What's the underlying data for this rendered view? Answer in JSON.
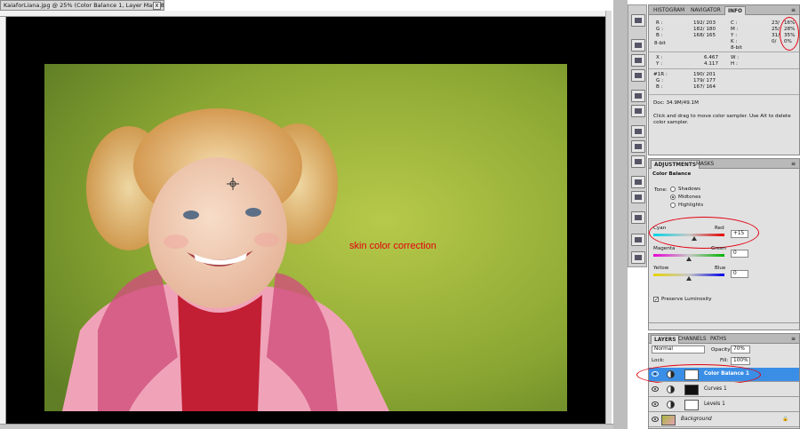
{
  "document": {
    "tab_title": "KaiaforLiana.jpg @ 25% (Color Balance 1, Layer Mask/8) *",
    "close_glyph": "x",
    "image_label": "skin color correction"
  },
  "info_panel": {
    "tabs": [
      "HISTOGRAM",
      "NAVIGATOR",
      "INFO"
    ],
    "active_tab": "INFO",
    "rgb_block": {
      "labels": [
        "R :",
        "G :",
        "B :"
      ],
      "values": [
        "192/  203",
        "182/  180",
        "168/  165"
      ],
      "bit": "8-bit"
    },
    "cmyk_block": {
      "labels": [
        "C :",
        "M :",
        "Y :",
        "K :"
      ],
      "values": [
        "23/",
        "25/",
        "31/",
        "0/"
      ],
      "values_after": [
        "16%",
        "28%",
        "35%",
        "0%"
      ],
      "bit": "8-bit"
    },
    "xy_block": {
      "labels": [
        "X :",
        "Y :"
      ],
      "values": [
        "6.467",
        "4.117"
      ]
    },
    "wh_block": {
      "labels": [
        "W :",
        "H :"
      ]
    },
    "sampler_block": {
      "labels": [
        "#1R :",
        "G :",
        "B :"
      ],
      "values": [
        "190/  201",
        "179/  177",
        "167/  164"
      ]
    },
    "doc_size": "Doc: 34.9M/49.1M",
    "hint": "Click and drag to move color sampler. Use Alt to delete color sampler."
  },
  "adjustments_panel": {
    "tabs": [
      "ADJUSTMENTS",
      "MASKS"
    ],
    "active_tab": "ADJUSTMENTS",
    "title": "Color Balance",
    "tone_label": "Tone:",
    "tone_options": [
      "Shadows",
      "Midtones",
      "Highlights"
    ],
    "tone_selected": "Midtones",
    "sliders": [
      {
        "left": "Cyan",
        "right": "Red",
        "value": "+15",
        "level": 0.575
      },
      {
        "left": "Magenta",
        "right": "Green",
        "value": "0",
        "level": 0.5
      },
      {
        "left": "Yellow",
        "right": "Blue",
        "value": "0",
        "level": 0.5
      }
    ],
    "preserve_luminosity": "Preserve Luminosity",
    "preserve_checked": true
  },
  "layers_panel": {
    "tabs": [
      "LAYERS",
      "CHANNELS",
      "PATHS"
    ],
    "active_tab": "LAYERS",
    "blend_mode": "Normal",
    "opacity_label": "Opacity:",
    "opacity_value": "70%",
    "lock_label": "Lock:",
    "fill_label": "Fill:",
    "fill_value": "100%",
    "layers": [
      {
        "name": "Color Balance 1",
        "selected": true
      },
      {
        "name": "Curves 1",
        "selected": false
      },
      {
        "name": "Levels 1",
        "selected": false
      },
      {
        "name": "Background",
        "selected": false
      }
    ]
  },
  "colors": {
    "annotation_red": "#e2000f",
    "selection_blue": "#3a8ee6",
    "panel_bg": "#e1e1e1"
  }
}
